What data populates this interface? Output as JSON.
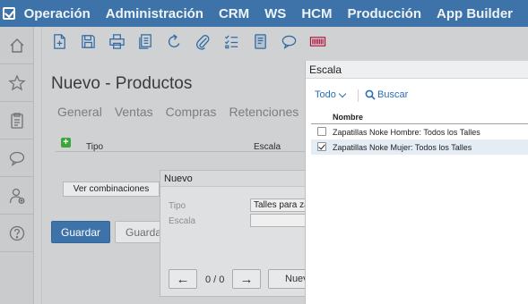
{
  "nav": {
    "menu": [
      "Operación",
      "Administración",
      "CRM",
      "WS",
      "HCM",
      "Producción",
      "App Builder"
    ]
  },
  "rail": {
    "icons": [
      "home-icon",
      "star-icon",
      "clipboard-icon",
      "chat-bubble-icon",
      "user-add-icon",
      "help-icon"
    ]
  },
  "toolbar": {
    "icons": [
      "new-document-icon",
      "save-icon",
      "print-icon",
      "copy-icon",
      "refresh-icon",
      "attach-icon",
      "checklist-icon",
      "notebook-icon",
      "comment-icon",
      "barcode-icon"
    ]
  },
  "page": {
    "title": "Nuevo - Productos",
    "tabs": [
      "General",
      "Ventas",
      "Compras",
      "Retenciones"
    ],
    "grid": {
      "columns": [
        "Tipo",
        "Escala"
      ]
    },
    "ver_combinaciones": "Ver combinaciones",
    "save_label": "Guardar",
    "save2_label": "Guarda"
  },
  "nuevo_dialog": {
    "title": "Nuevo",
    "tipo_label": "Tipo",
    "tipo_value": "Talles para za",
    "escala_label": "Escala",
    "escala_value": "",
    "pager": "0 / 0",
    "prev_symbol": "←",
    "next_symbol": "→",
    "new_label": "Nuev"
  },
  "escala_panel": {
    "title": "Escala",
    "filter_label": "Todo",
    "search_label": "Buscar",
    "column": "Nombre",
    "rows": [
      {
        "label": "Zapatillas Noke Hombre: Todos los Talles",
        "checked": false
      },
      {
        "label": "Zapatillas Noke Mujer: Todos los Talles",
        "checked": true
      }
    ]
  },
  "colors": {
    "nav_bg": "#3d73a8",
    "link": "#2a6eb5",
    "add_green": "#3aa63a"
  }
}
